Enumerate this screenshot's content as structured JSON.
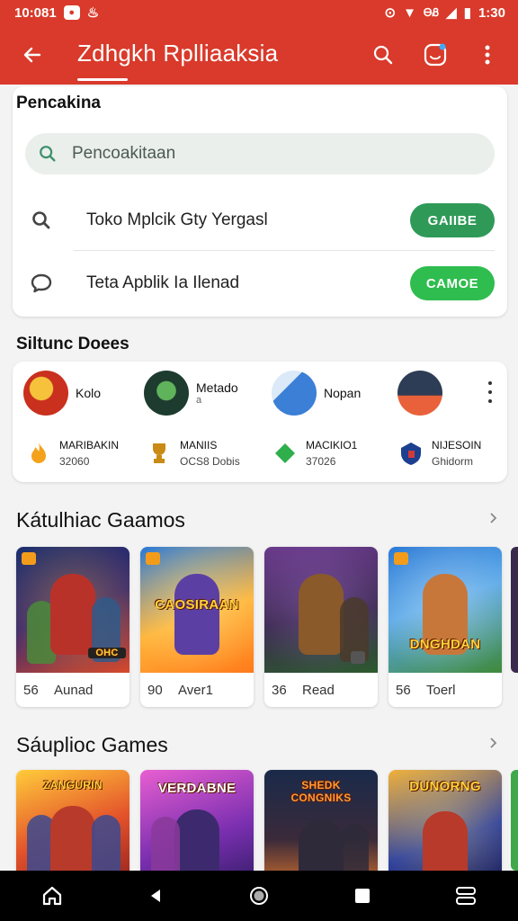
{
  "status": {
    "time": "10:081",
    "right_time": "1:30",
    "signal_text": "ᎾᏰ"
  },
  "header": {
    "title": "Zdhgkh Rplliaaksia"
  },
  "search_section": {
    "label": "Pencakina",
    "search_placeholder": "Pencoakitaan",
    "results": [
      {
        "text": "Toko Mplcik Gty Yergasl",
        "button": "GAIIBE",
        "button_color": "#2f9a58"
      },
      {
        "text": "Teta Apblik Ia Ilenad",
        "button": "CAMOE",
        "button_color": "#2ebd4e"
      }
    ]
  },
  "suggestions_section": {
    "label": "Siltunc Doees",
    "apps": [
      {
        "name": "Kolo",
        "colors": [
          "#c9301e",
          "#f6c23b"
        ]
      },
      {
        "name": "Metado",
        "sub": "a",
        "colors": [
          "#1e3b2f",
          "#5fb35a"
        ]
      },
      {
        "name": "Nopan",
        "colors": [
          "#3b7fd6",
          "#dbe9f8"
        ]
      },
      {
        "name": "",
        "colors": [
          "#e8613a",
          "#2d3d55"
        ]
      }
    ],
    "stats": [
      {
        "label": "MARIBAKIN",
        "value": "32060",
        "color": "#f4a21b"
      },
      {
        "label": "MANIIS",
        "value": "OCS8 Dobis",
        "color": "#c98b16"
      },
      {
        "label": "MACIKIO1",
        "value": "37026",
        "color": "#2fae4c"
      },
      {
        "label": "NIJESOIN",
        "value": "Ghidorm",
        "color": "#1d3f8f"
      }
    ]
  },
  "featured_games": {
    "title": "Kátulhiac Gaamos",
    "games": [
      {
        "num": "56",
        "name": "Aunad",
        "logo": "OHC",
        "bg": [
          "#1c2f6e",
          "#d84a2a"
        ],
        "hero": "#b8322a"
      },
      {
        "num": "90",
        "name": "Aver1",
        "logo": "CAOSIRAAN",
        "bg": [
          "#ffb43a",
          "#2a79d8"
        ],
        "hero": "#5c3fa3"
      },
      {
        "num": "36",
        "name": "Read",
        "logo": "",
        "bg": [
          "#6a3a8c",
          "#2d5a2f"
        ],
        "hero": "#8a5a2b"
      },
      {
        "num": "56",
        "name": "Toerl",
        "logo": "DNGHDAN",
        "bg": [
          "#2c7ad6",
          "#3f8a3a"
        ],
        "hero": "#c8773a"
      }
    ]
  },
  "popular_games": {
    "title": "Sáuplioc Games",
    "games": [
      {
        "logo": "ZANGURIN",
        "bg": [
          "#e4532b",
          "#ffcc3a"
        ],
        "hero": "#3b4a8f"
      },
      {
        "logo": "VERDABNE",
        "bg": [
          "#7a2fb0",
          "#e85fd1"
        ],
        "hero": "#3d2a6e"
      },
      {
        "logo": "SHEDK CONGNIKS",
        "bg": [
          "#1a2a4a",
          "#e87a2a"
        ],
        "hero": "#2e2a3a"
      },
      {
        "logo": "DUNORNG",
        "bg": [
          "#2a3ea0",
          "#f2b23a"
        ],
        "hero": "#b83a2a"
      }
    ]
  }
}
